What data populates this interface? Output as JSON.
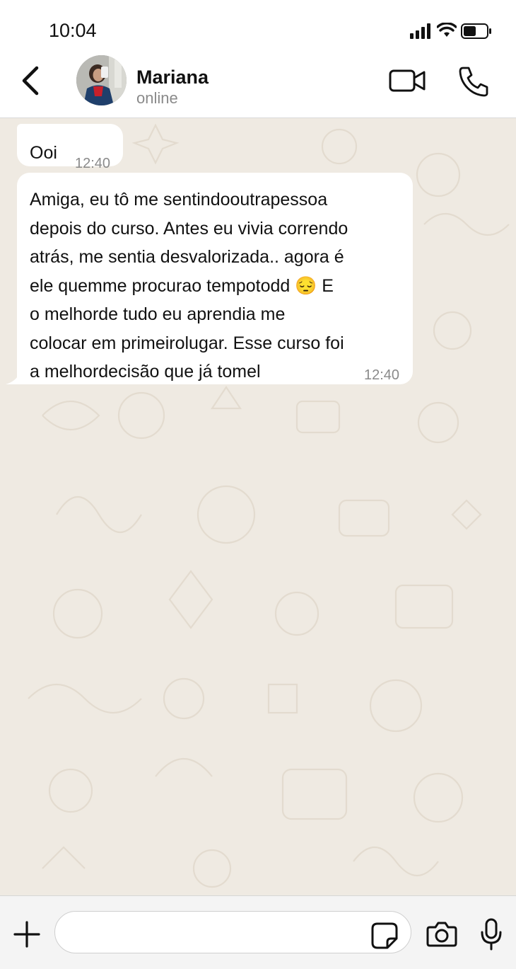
{
  "status_bar": {
    "time": "10:04",
    "icons": [
      "signal-icon",
      "wifi-icon",
      "battery-icon"
    ]
  },
  "header": {
    "back_icon": "chevron-left-icon",
    "contact_name": "Mariana",
    "contact_status": "online",
    "actions": [
      "video-call-icon",
      "phone-icon"
    ]
  },
  "messages": [
    {
      "text": "Ooi",
      "time": "12:40"
    },
    {
      "text": "Amiga, eu tô me sentindooutrapessoa\ndepois do curso. Antes eu vivia correndo\natrás, me sentia desvalorizada.. agora é\nele quemme procurao tempotodd 😔 E\no melhorde tudo eu aprendia me\ncolocar em primeirolugar. Esse curso foi\na melhordecisão que já tomel",
      "time": "12:40"
    }
  ],
  "input_bar": {
    "icons": [
      "plus-icon",
      "sticker-icon",
      "camera-icon",
      "microphone-icon"
    ],
    "placeholder": ""
  },
  "colors": {
    "chat_background": "#efeae2",
    "bubble_background": "#ffffff",
    "header_background": "#ffffff",
    "input_bar_background": "#f4f4f4",
    "secondary_text": "#8a8a8a"
  }
}
